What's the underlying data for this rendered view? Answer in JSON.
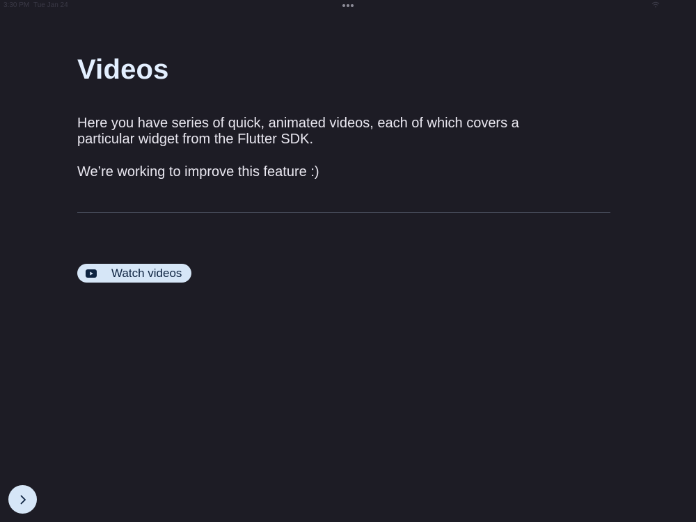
{
  "status_bar": {
    "time": "3:30 PM",
    "date": "Tue Jan 24"
  },
  "page": {
    "title": "Videos",
    "description": "Here you have series of quick, animated videos, each of which covers a particular widget from the Flutter SDK.",
    "note": "We’re working to improve this feature :)"
  },
  "actions": {
    "watch_videos_label": "Watch videos",
    "watch_videos_icon": "youtube-icon",
    "next_icon": "chevron-right-icon"
  },
  "colors": {
    "background": "#1d1c25",
    "button_bg": "#d6e6f7",
    "button_text": "#0d2340",
    "title": "#e3efff"
  }
}
